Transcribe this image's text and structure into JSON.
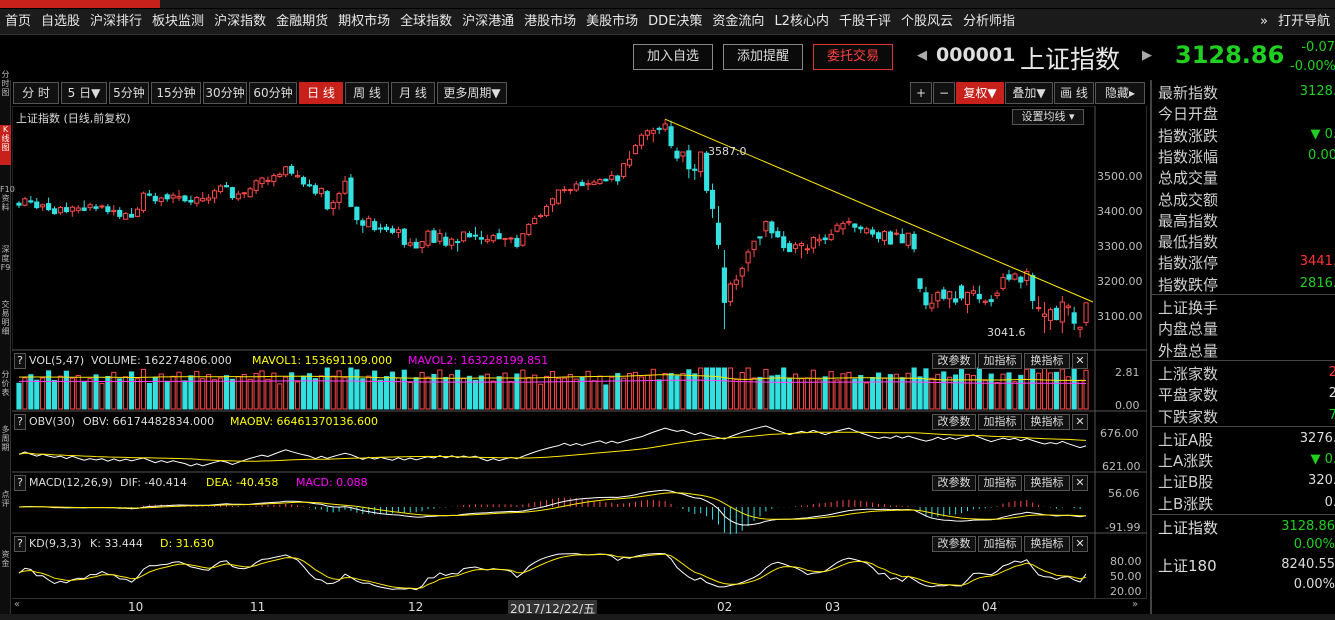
{
  "nav": {
    "items": [
      "首页",
      "自选股",
      "沪深排行",
      "板块监测",
      "沪深指数",
      "金融期货",
      "期权市场",
      "全球指数",
      "沪深港通",
      "港股市场",
      "美股市场",
      "DDE决策",
      "资金流向",
      "L2核心内",
      "千股千评",
      "个股风云",
      "分析师指"
    ],
    "more": "»",
    "right": "打开导航"
  },
  "header": {
    "add_watch": "加入自选",
    "add_alert": "添加提醒",
    "trade": "委托交易",
    "code": "000001",
    "name": "上证指数",
    "price": "3128.86",
    "chg": "-0.07",
    "pct": "-0.00%"
  },
  "periods": [
    "分 时",
    "5 日▼",
    "5分钟",
    "15分钟",
    "30分钟",
    "60分钟",
    "日 线",
    "周 线",
    "月 线",
    "更多周期▼"
  ],
  "right_tools": {
    "plus": "+",
    "minus": "−",
    "fq": "复权▼",
    "overlay": "叠加▼",
    "draw": "画 线",
    "hide": "隐藏▸"
  },
  "leftbar": [
    "分时图",
    "K线图",
    "F10资料",
    "深度F9",
    "交易明细",
    "分价表",
    "多周期",
    "点评",
    "资金"
  ],
  "kline": {
    "title": "上证指数 (日线,前复权)",
    "ma_btn": "设置均线 ▾",
    "high_label": "3587.0",
    "low_label": "3041.6"
  },
  "panels": {
    "vol": {
      "name": "VOL(5,47)",
      "v1": "VOLUME: 162274806.000",
      "v2": "MAVOL1: 153691109.000",
      "v3": "MAVOL2: 163228199.851",
      "ytop": "2.81",
      "ybot": "0.00"
    },
    "obv": {
      "name": "OBV(30)",
      "v1": "OBV: 66174482834.000",
      "v2": "MAOBV: 66461370136.600",
      "ytop": "676.00",
      "ybot": "621.00"
    },
    "macd": {
      "name": "MACD(12,26,9)",
      "v1": "DIF: -40.414",
      "v2": "DEA: -40.458",
      "v3": "MACD: 0.088",
      "ytop": "56.06",
      "ybot": "-91.99"
    },
    "kd": {
      "name": "KD(9,3,3)",
      "v1": "K: 33.444",
      "v2": "D: 31.630",
      "y1": "80.00",
      "y2": "50.00",
      "y3": "20.00"
    }
  },
  "panel_btns": {
    "param": "改参数",
    "add": "加指标",
    "switch": "换指标",
    "close": "✕",
    "help": "?"
  },
  "price_axis": [
    "3500.00",
    "3400.00",
    "3300.00",
    "3200.00",
    "3100.00"
  ],
  "xaxis": {
    "labels": [
      "10",
      "11",
      "12",
      "2017/12/22/五",
      "02",
      "03",
      "04"
    ]
  },
  "rightpanel": {
    "rows": [
      {
        "label": "最新指数",
        "value": "3128.",
        "color": "green"
      },
      {
        "label": "今日开盘",
        "value": "",
        "color": "white"
      },
      {
        "label": "指数涨跌",
        "value": "▼ 0.",
        "color": "green"
      },
      {
        "label": "指数涨幅",
        "value": "0.00",
        "color": "green"
      },
      {
        "label": "总成交量",
        "value": "",
        "color": "white"
      },
      {
        "label": "总成交额",
        "value": "",
        "color": "white"
      },
      {
        "label": "最高指数",
        "value": "",
        "color": "white"
      },
      {
        "label": "最低指数",
        "value": "",
        "color": "white"
      },
      {
        "label": "指数涨停",
        "value": "3441.",
        "color": "red"
      },
      {
        "label": "指数跌停",
        "value": "2816.",
        "color": "green"
      },
      {
        "label": "上证换手",
        "value": "",
        "color": "white"
      },
      {
        "label": "内盘总量",
        "value": "",
        "color": "white"
      },
      {
        "label": "外盘总量",
        "value": "",
        "color": "white"
      },
      {
        "label": "上涨家数",
        "value": "2",
        "color": "red"
      },
      {
        "label": "平盘家数",
        "value": "2",
        "color": "white"
      },
      {
        "label": "下跌家数",
        "value": "7",
        "color": "green"
      },
      {
        "label": "上证A股",
        "value": "3276.",
        "color": "white"
      },
      {
        "label": "上A涨跌",
        "value": "▼ 0.",
        "color": "green"
      },
      {
        "label": "上证B股",
        "value": "320.",
        "color": "white"
      },
      {
        "label": "上B涨跌",
        "value": "0.",
        "color": "white"
      }
    ],
    "index_name": "上证指数",
    "index_price": "3128.86",
    "index_pct": "0.00%",
    "sz180_name": "上证180",
    "sz180_price": "8240.55",
    "sz180_pct": "0.00%"
  },
  "chart_data": {
    "type": "candlestick",
    "ohlc": [
      [
        3377,
        3382,
        3365,
        3372
      ],
      [
        3372,
        3393,
        3369,
        3388
      ],
      [
        3383,
        3395,
        3376,
        3380
      ],
      [
        3380,
        3390,
        3362,
        3366
      ],
      [
        3368,
        3376,
        3358,
        3373
      ],
      [
        3376,
        3391,
        3357,
        3361
      ],
      [
        3363,
        3369,
        3348,
        3351
      ],
      [
        3353,
        3370,
        3348,
        3366
      ],
      [
        3366,
        3379,
        3352,
        3356
      ],
      [
        3357,
        3371,
        3343,
        3367
      ],
      [
        3359,
        3372,
        3352,
        3365
      ],
      [
        3365,
        3384,
        3357,
        3359
      ],
      [
        3366,
        3378,
        3358,
        3373
      ],
      [
        3368,
        3375,
        3357,
        3364
      ],
      [
        3369,
        3374,
        3363,
        3370
      ],
      [
        3368,
        3375,
        3349,
        3356
      ],
      [
        3356,
        3372,
        3346,
        3359
      ],
      [
        3359,
        3367,
        3337,
        3344
      ],
      [
        3337,
        3355,
        3336,
        3351
      ],
      [
        3349,
        3365,
        3342,
        3342
      ],
      [
        3344,
        3367,
        3342,
        3362
      ],
      [
        3359,
        3406,
        3353,
        3402
      ],
      [
        3400,
        3410,
        3394,
        3397
      ],
      [
        3394,
        3403,
        3375,
        3383
      ],
      [
        3381,
        3393,
        3370,
        3390
      ],
      [
        3398,
        3403,
        3381,
        3388
      ],
      [
        3390,
        3404,
        3377,
        3397
      ],
      [
        3390,
        3410,
        3383,
        3394
      ],
      [
        3395,
        3398,
        3379,
        3383
      ],
      [
        3384,
        3396,
        3372,
        3380
      ],
      [
        3377,
        3395,
        3369,
        3391
      ],
      [
        3383,
        3405,
        3380,
        3389
      ],
      [
        3385,
        3400,
        3375,
        3390
      ],
      [
        3390,
        3413,
        3377,
        3408
      ],
      [
        3406,
        3424,
        3401,
        3420
      ],
      [
        3421,
        3430,
        3416,
        3418
      ],
      [
        3416,
        3418,
        3385,
        3391
      ],
      [
        3388,
        3408,
        3383,
        3400
      ],
      [
        3402,
        3405,
        3390,
        3403
      ],
      [
        3393,
        3418,
        3391,
        3413
      ],
      [
        3409,
        3437,
        3400,
        3433
      ],
      [
        3426,
        3443,
        3415,
        3440
      ],
      [
        3434,
        3444,
        3422,
        3434
      ],
      [
        3431,
        3452,
        3419,
        3446
      ],
      [
        3444,
        3454,
        3440,
        3449
      ],
      [
        3448,
        3470,
        3442,
        3468
      ],
      [
        3469,
        3475,
        3446,
        3452
      ],
      [
        3443,
        3459,
        3440,
        3446
      ],
      [
        3441,
        3446,
        3418,
        3425
      ],
      [
        3423,
        3436,
        3417,
        3422
      ],
      [
        3421,
        3427,
        3396,
        3402
      ],
      [
        3401,
        3416,
        3392,
        3414
      ],
      [
        3406,
        3410,
        3359,
        3363
      ],
      [
        3364,
        3385,
        3346,
        3379
      ],
      [
        3379,
        3406,
        3361,
        3401
      ],
      [
        3402,
        3445,
        3398,
        3432
      ],
      [
        3440,
        3450,
        3367,
        3369
      ],
      [
        3367,
        3369,
        3324,
        3336
      ],
      [
        3333,
        3339,
        3303,
        3322
      ],
      [
        3318,
        3346,
        3318,
        3339
      ],
      [
        3331,
        3339,
        3306,
        3311
      ],
      [
        3315,
        3326,
        3303,
        3313
      ],
      [
        3317,
        3325,
        3305,
        3311
      ],
      [
        3313,
        3321,
        3299,
        3304
      ],
      [
        3304,
        3319,
        3290,
        3311
      ],
      [
        3312,
        3315,
        3266,
        3274
      ],
      [
        3272,
        3289,
        3268,
        3278
      ],
      [
        3279,
        3289,
        3264,
        3265
      ],
      [
        3266,
        3283,
        3252,
        3281
      ],
      [
        3272,
        3311,
        3266,
        3307
      ],
      [
        3308,
        3315,
        3278,
        3279
      ],
      [
        3282,
        3313,
        3274,
        3301
      ],
      [
        3292,
        3304,
        3267,
        3272
      ],
      [
        3272,
        3291,
        3261,
        3287
      ],
      [
        3281,
        3288,
        3256,
        3279
      ],
      [
        3283,
        3305,
        3279,
        3305
      ],
      [
        3301,
        3307,
        3291,
        3293
      ],
      [
        3297,
        3318,
        3285,
        3296
      ],
      [
        3291,
        3308,
        3274,
        3287
      ],
      [
        3282,
        3298,
        3276,
        3286
      ],
      [
        3283,
        3300,
        3277,
        3296
      ],
      [
        3301,
        3313,
        3288,
        3288
      ],
      [
        3288,
        3290,
        3268,
        3289
      ],
      [
        3288,
        3293,
        3277,
        3290
      ],
      [
        3289,
        3298,
        3264,
        3269
      ],
      [
        3272,
        3301,
        3268,
        3301
      ],
      [
        3299,
        3327,
        3295,
        3324
      ],
      [
        3326,
        3346,
        3324,
        3339
      ],
      [
        3345,
        3351,
        3339,
        3346
      ],
      [
        3346,
        3374,
        3342,
        3369
      ],
      [
        3373,
        3391,
        3355,
        3388
      ],
      [
        3377,
        3411,
        3373,
        3410
      ],
      [
        3410,
        3420,
        3403,
        3411
      ],
      [
        3409,
        3414,
        3399,
        3411
      ],
      [
        3410,
        3433,
        3405,
        3425
      ],
      [
        3429,
        3436,
        3421,
        3421
      ],
      [
        3423,
        3436,
        3410,
        3426
      ],
      [
        3424,
        3436,
        3422,
        3430
      ],
      [
        3426,
        3440,
        3423,
        3436
      ],
      [
        3437,
        3439,
        3431,
        3433
      ],
      [
        3437,
        3458,
        3431,
        3446
      ],
      [
        3445,
        3448,
        3423,
        3433
      ],
      [
        3444,
        3477,
        3438,
        3476
      ],
      [
        3472,
        3507,
        3465,
        3487
      ],
      [
        3501,
        3525,
        3499,
        3521
      ],
      [
        3522,
        3552,
        3512,
        3547
      ],
      [
        3547,
        3562,
        3535,
        3558
      ],
      [
        3552,
        3566,
        3529,
        3559
      ],
      [
        3564,
        3569,
        3550,
        3562
      ],
      [
        3562,
        3587,
        3556,
        3575
      ],
      [
        3568,
        3583,
        3514,
        3521
      ],
      [
        3507,
        3516,
        3482,
        3490
      ],
      [
        3495,
        3505,
        3479,
        3505
      ],
      [
        3508,
        3523,
        3439,
        3463
      ],
      [
        3462,
        3475,
        3435,
        3459
      ],
      [
        3456,
        3505,
        3443,
        3505
      ],
      [
        3502,
        3508,
        3402,
        3409
      ],
      [
        3409,
        3426,
        3340,
        3364
      ],
      [
        3327,
        3370,
        3263,
        3274
      ],
      [
        3215,
        3260,
        3062,
        3129
      ],
      [
        3131,
        3181,
        3120,
        3175
      ],
      [
        3174,
        3198,
        3160,
        3185
      ],
      [
        3195,
        3219,
        3166,
        3214
      ],
      [
        3228,
        3262,
        3206,
        3255
      ],
      [
        3261,
        3282,
        3242,
        3282
      ],
      [
        3293,
        3293,
        3272,
        3290
      ],
      [
        3308,
        3334,
        3292,
        3331
      ],
      [
        3330,
        3334,
        3289,
        3303
      ],
      [
        3306,
        3317,
        3290,
        3293
      ],
      [
        3293,
        3307,
        3257,
        3266
      ],
      [
        3276,
        3283,
        3255,
        3256
      ],
      [
        3264,
        3280,
        3252,
        3273
      ],
      [
        3271,
        3281,
        3239,
        3276
      ],
      [
        3261,
        3274,
        3250,
        3263
      ],
      [
        3265,
        3295,
        3252,
        3291
      ],
      [
        3283,
        3300,
        3270,
        3287
      ],
      [
        3290,
        3299,
        3275,
        3286
      ],
      [
        3286,
        3312,
        3282,
        3299
      ],
      [
        3307,
        3328,
        3304,
        3322
      ],
      [
        3313,
        3333,
        3298,
        3326
      ],
      [
        3328,
        3341,
        3321,
        3331
      ],
      [
        3325,
        3327,
        3304,
        3317
      ],
      [
        3317,
        3322,
        3302,
        3313
      ],
      [
        3303,
        3318,
        3299,
        3313
      ],
      [
        3310,
        3318,
        3292,
        3300
      ],
      [
        3303,
        3307,
        3279,
        3289
      ],
      [
        3284,
        3310,
        3272,
        3306
      ],
      [
        3305,
        3309,
        3273,
        3275
      ],
      [
        3300,
        3312,
        3296,
        3302
      ],
      [
        3299,
        3314,
        3278,
        3278
      ],
      [
        3272,
        3302,
        3264,
        3302
      ],
      [
        3299,
        3307,
        3254,
        3263
      ],
      [
        3188,
        3189,
        3154,
        3164
      ],
      [
        3153,
        3168,
        3112,
        3123
      ],
      [
        3115,
        3150,
        3106,
        3127
      ],
      [
        3133,
        3158,
        3115,
        3154
      ],
      [
        3160,
        3168,
        3134,
        3139
      ],
      [
        3138,
        3158,
        3114,
        3156
      ],
      [
        3138,
        3157,
        3123,
        3130
      ],
      [
        3170,
        3175,
        3134,
        3140
      ],
      [
        3124,
        3156,
        3102,
        3154
      ],
      [
        3152,
        3171,
        3145,
        3158
      ],
      [
        3149,
        3171,
        3127,
        3138
      ],
      [
        3129,
        3136,
        3122,
        3132
      ],
      [
        3136,
        3147,
        3119,
        3131
      ],
      [
        3146,
        3159,
        3138,
        3152
      ],
      [
        3164,
        3202,
        3158,
        3191
      ],
      [
        3198,
        3210,
        3181,
        3187
      ],
      [
        3187,
        3204,
        3184,
        3200
      ],
      [
        3192,
        3196,
        3164,
        3180
      ],
      [
        3184,
        3214,
        3171,
        3206
      ],
      [
        3196,
        3203,
        3112,
        3134
      ],
      [
        3115,
        3144,
        3106,
        3116
      ],
      [
        3094,
        3130,
        3052,
        3100
      ],
      [
        3084,
        3116,
        3060,
        3111
      ],
      [
        3114,
        3121,
        3084,
        3086
      ],
      [
        3080,
        3145,
        3052,
        3130
      ],
      [
        3116,
        3126,
        3096,
        3120
      ],
      [
        3103,
        3118,
        3060,
        3077
      ],
      [
        3062,
        3069,
        3041,
        3067
      ],
      [
        3079,
        3129,
        3070,
        3128
      ]
    ]
  }
}
